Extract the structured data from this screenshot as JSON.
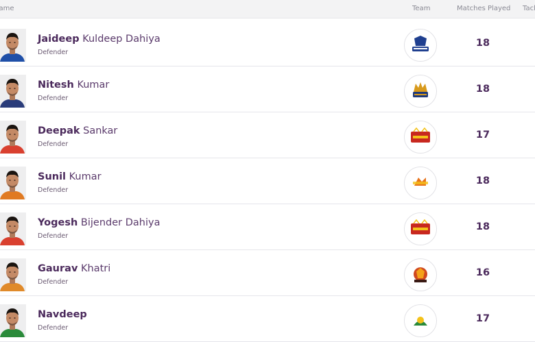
{
  "header": {
    "name": "Name",
    "team": "Team",
    "matches_played": "Matches Played",
    "tackles": "Tackles"
  },
  "players": [
    {
      "first": "Jaideep",
      "last": "Kuldeep Dahiya",
      "role": "Defender",
      "matches": "18",
      "team_logo": "haryana-steelers-logo",
      "jersey": "#1f4fa8",
      "logo_color": "#1f3f8f"
    },
    {
      "first": "Nitesh",
      "last": "Kumar",
      "role": "Defender",
      "matches": "18",
      "team_logo": "tamil-thalaivas-logo",
      "jersey": "#2a3c7a",
      "logo_color": "#d89a1c"
    },
    {
      "first": "Deepak",
      "last": "Sankar",
      "role": "Defender",
      "matches": "17",
      "team_logo": "bengaluru-bulls-logo",
      "jersey": "#d9402f",
      "logo_color": "#c8281f"
    },
    {
      "first": "Sunil",
      "last": "Kumar",
      "role": "Defender",
      "matches": "18",
      "team_logo": "u-mumba-logo",
      "jersey": "#e07a22",
      "logo_color": "#e8731a"
    },
    {
      "first": "Yogesh",
      "last": "Bijender Dahiya",
      "role": "Defender",
      "matches": "18",
      "team_logo": "bengaluru-bulls-logo",
      "jersey": "#d9402f",
      "logo_color": "#c8281f"
    },
    {
      "first": "Gaurav",
      "last": "Khatri",
      "role": "Defender",
      "matches": "16",
      "team_logo": "puneri-paltan-logo",
      "jersey": "#e08a2a",
      "logo_color": "#d0481f"
    },
    {
      "first": "Navdeep",
      "last": "",
      "role": "Defender",
      "matches": "17",
      "team_logo": "gujarat-giants-logo",
      "jersey": "#2a8a3a",
      "logo_color": "#2a8a3a"
    }
  ]
}
